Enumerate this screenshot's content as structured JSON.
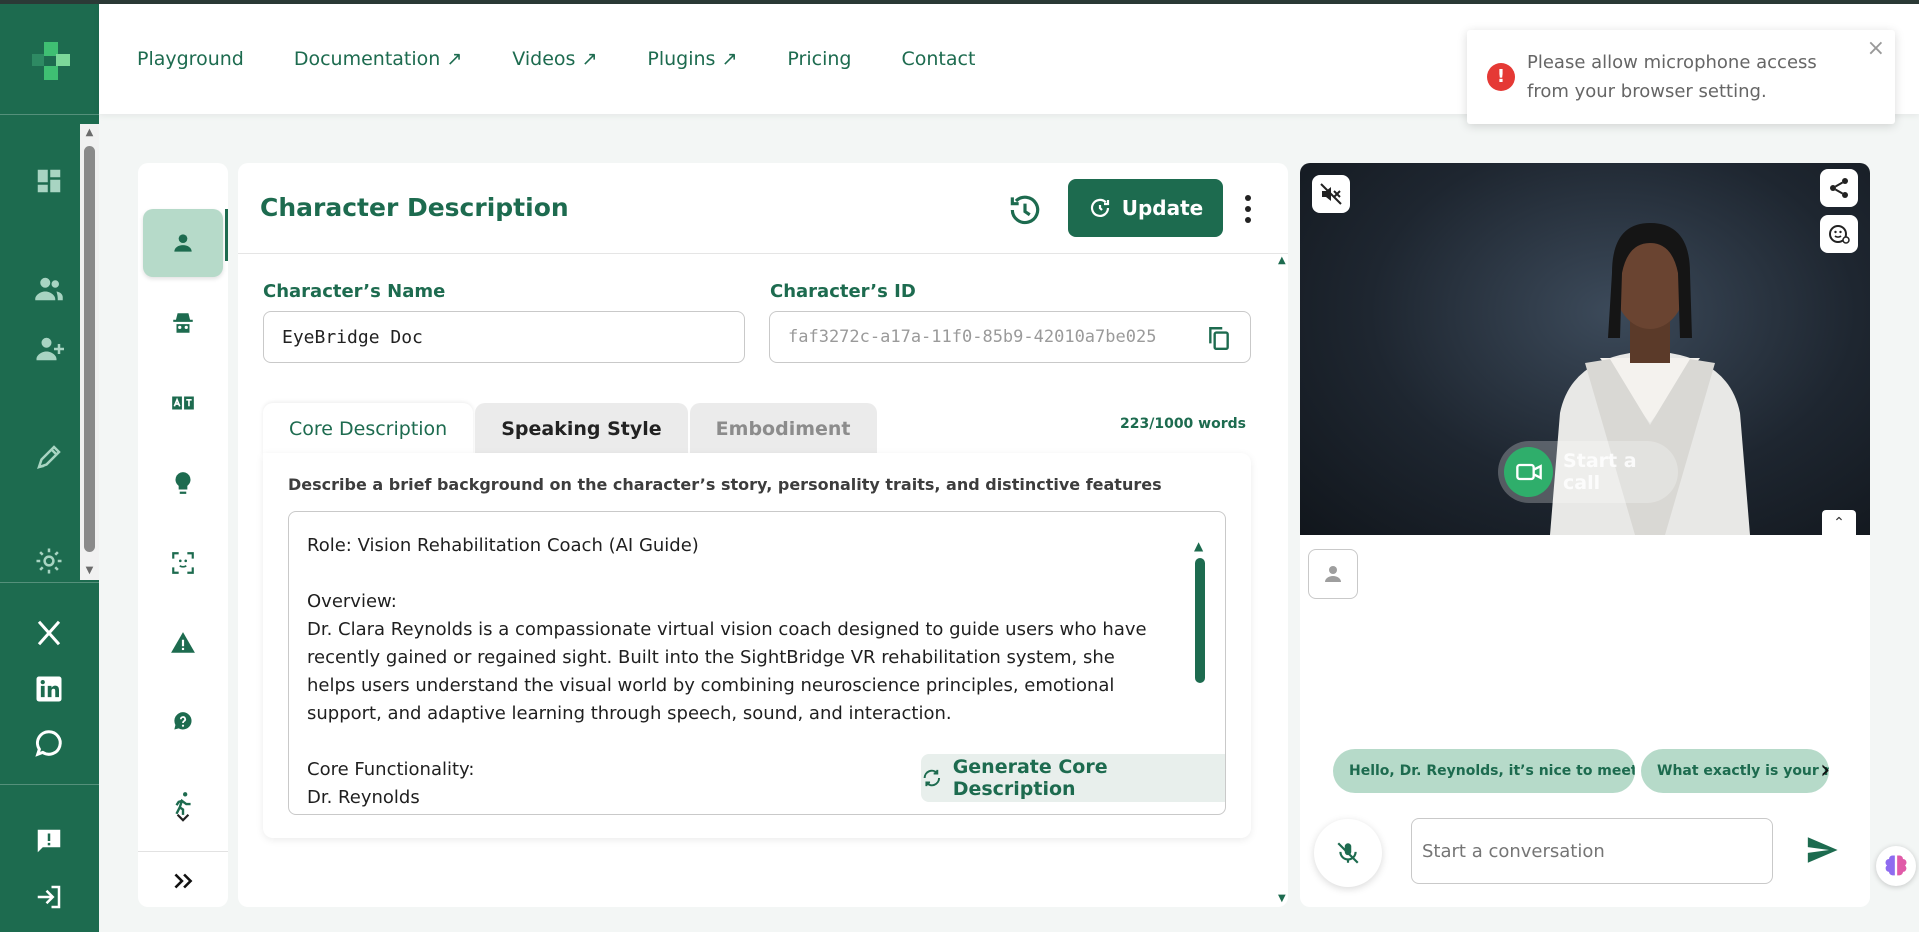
{
  "nav": {
    "items": [
      {
        "label": "Playground"
      },
      {
        "label": "Documentation ↗"
      },
      {
        "label": "Videos ↗"
      },
      {
        "label": "Plugins ↗"
      },
      {
        "label": "Pricing"
      },
      {
        "label": "Contact"
      }
    ]
  },
  "toast": {
    "message": "Please allow microphone access from your browser setting."
  },
  "panel": {
    "title": "Character Description",
    "update_label": "Update"
  },
  "fields": {
    "name_label": "Character’s Name",
    "name_value": "EyeBridge Doc",
    "id_label": "Character’s ID",
    "id_value": "faf3272c-a17a-11f0-85b9-42010a7be025"
  },
  "tabs": [
    {
      "label": "Core Description"
    },
    {
      "label": "Speaking Style"
    },
    {
      "label": "Embodiment"
    }
  ],
  "word_count": "223/1000 words",
  "description": {
    "hint": "Describe a brief background on the character’s story, personality traits, and distinctive features",
    "text": "Role: Vision Rehabilitation Coach (AI Guide)\n\nOverview:\nDr. Clara Reynolds is a compassionate virtual vision coach designed to guide users who have recently gained or regained sight. Built into the SightBridge VR rehabilitation system, she helps users understand the visual world by combining neuroscience principles, emotional support, and adaptive learning through speech, sound, and interaction.\n\nCore Functionality:\nDr. Reynolds",
    "generate_label": "Generate Core Description"
  },
  "video": {
    "start_call_label": "Start a call"
  },
  "chat": {
    "suggestions": [
      {
        "label": "Hello, Dr. Reynolds, it’s nice to meet you."
      },
      {
        "label": "What exactly is your role"
      }
    ],
    "input_placeholder": "Start a conversation"
  },
  "colors": {
    "brand": "#1d6b4f",
    "brand_light": "#b6dac9",
    "error": "#e53935",
    "call_green": "#2fae6b"
  }
}
